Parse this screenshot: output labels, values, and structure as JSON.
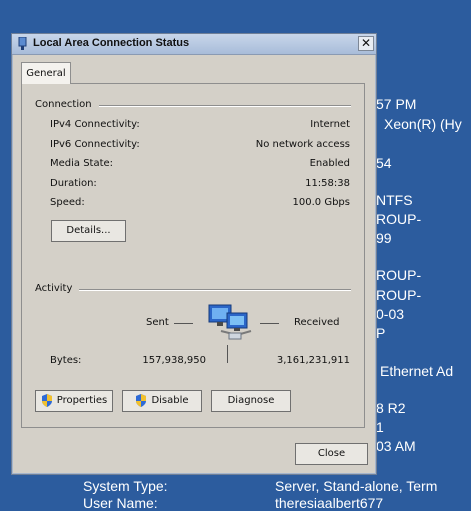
{
  "desktop": {
    "lines": [
      "57 PM",
      "Xeon(R) (Hy",
      "54",
      "NTFS",
      "ROUP-",
      "99",
      "ROUP-",
      "ROUP-",
      "0-03",
      "P",
      "Ethernet Ad",
      "8 R2",
      "1",
      "03 AM"
    ],
    "system_type_label": "System Type:",
    "system_type_value": "Server, Stand-alone, Term",
    "user_name_label": "User Name:",
    "user_name_value": "theresiaalbert677"
  },
  "dialog": {
    "title": "Local Area Connection Status",
    "close_glyph": "✕",
    "tab_label": "General",
    "connection": {
      "group_label": "Connection",
      "rows": [
        {
          "label": "IPv4 Connectivity:",
          "value": "Internet"
        },
        {
          "label": "IPv6 Connectivity:",
          "value": "No network access"
        },
        {
          "label": "Media State:",
          "value": "Enabled"
        },
        {
          "label": "Duration:",
          "value": "11:58:38"
        },
        {
          "label": "Speed:",
          "value": "100.0 Gbps"
        }
      ],
      "details_button": "Details..."
    },
    "activity": {
      "group_label": "Activity",
      "sent_label": "Sent",
      "received_label": "Received",
      "bytes_label": "Bytes:",
      "bytes_sent": "157,938,950",
      "bytes_received": "3,161,231,911",
      "icon": "network-computers-icon"
    },
    "buttons": {
      "properties": "Properties",
      "disable": "Disable",
      "diagnose": "Diagnose",
      "close": "Close"
    }
  }
}
